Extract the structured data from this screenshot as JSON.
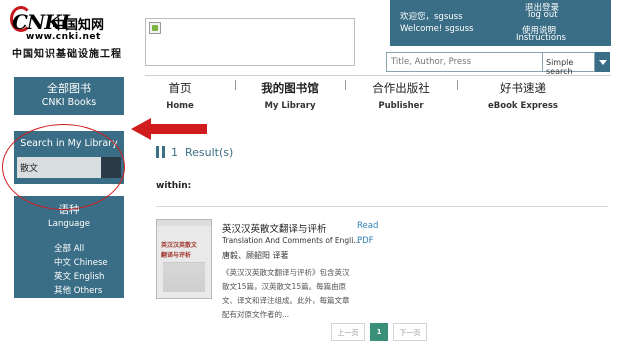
{
  "header": {
    "logo_main": "CNKI",
    "logo_cn": "中国知网",
    "logo_url": "www.cnki.net",
    "logo_sub": "中国知识基础设施工程",
    "user": {
      "greet_cn": "欢迎您，sgsuss",
      "greet_en": "Welcome! sgsuss",
      "logout_cn": "退出登录",
      "logout_en": "log out",
      "help_cn": "使用说明",
      "help_en": "Instructions"
    },
    "search": {
      "placeholder": "Title, Author, Press",
      "scope": "Simple search"
    }
  },
  "nav": {
    "items": [
      {
        "cn": "首页",
        "en": "Home"
      },
      {
        "cn": "我的图书馆",
        "en": "My Library"
      },
      {
        "cn": "合作出版社",
        "en": "Publisher"
      },
      {
        "cn": "好书速递",
        "en": "eBook Express"
      }
    ]
  },
  "sidebar": {
    "books_cn": "全部图书",
    "books_en": "CNKI Books",
    "search_title": "Search in My Library",
    "search_value": "散文",
    "lang_cn": "语种",
    "lang_en": "Language",
    "lang_options": [
      "全部  All",
      "中文  Chinese",
      "英文  English",
      "其他  Others"
    ]
  },
  "results": {
    "count": "1",
    "count_label": "Result(s)",
    "within": "within:"
  },
  "book": {
    "cover_line1": "英汉汉英散文",
    "cover_line2": "翻译与评析",
    "title_cn": "英汉汉英散文翻译与评析",
    "title_en": "Translation And Comments of Engli...",
    "author": "唐毅、顾韶阳 译著",
    "desc": "《英汉汉英散文翻译与评析》包含英汉散文15篇，汉英散文15篇。每篇由原文、译文和译注组成。此外，每篇文章配有对原文作者的...",
    "read": "Read",
    "pdf": "PDF"
  },
  "pager": {
    "prev": "上一页",
    "current": "1",
    "next": "下一页"
  },
  "colors": {
    "primary": "#3a6d86",
    "accent_red": "#d01c1c",
    "pager_active": "#3a8f79",
    "link": "#2f7fb3"
  }
}
